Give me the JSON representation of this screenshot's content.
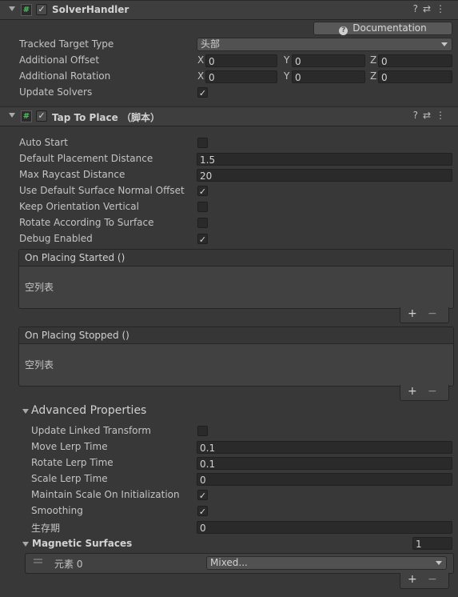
{
  "solver": {
    "title": "SolverHandler",
    "documentation_label": "Documentation",
    "tracked_target_type_label": "Tracked Target Type",
    "tracked_target_type_value": "头部",
    "additional_offset_label": "Additional Offset",
    "additional_offset": {
      "x": "0",
      "y": "0",
      "z": "0"
    },
    "additional_rotation_label": "Additional Rotation",
    "additional_rotation": {
      "x": "0",
      "y": "0",
      "z": "0"
    },
    "axis_x": "X",
    "axis_y": "Y",
    "axis_z": "Z",
    "update_solvers_label": "Update Solvers",
    "update_solvers_checked": true
  },
  "tap": {
    "title": "Tap To Place （脚本）",
    "auto_start_label": "Auto Start",
    "default_placement_distance_label": "Default Placement Distance",
    "default_placement_distance": "1.5",
    "max_raycast_distance_label": "Max Raycast Distance",
    "max_raycast_distance": "20",
    "use_default_surface_normal_offset_label": "Use Default Surface Normal Offset",
    "keep_orientation_vertical_label": "Keep Orientation Vertical",
    "rotate_according_to_surface_label": "Rotate According To Surface",
    "debug_enabled_label": "Debug Enabled",
    "on_placing_started_label": "On Placing Started ()",
    "on_placing_stopped_label": "On Placing Stopped ()",
    "empty_list_label": "空列表",
    "plus": "+",
    "minus": "−",
    "advanced_properties_label": "Advanced Properties",
    "update_linked_transform_label": "Update Linked Transform",
    "move_lerp_time_label": "Move Lerp Time",
    "move_lerp_time": "0.1",
    "rotate_lerp_time_label": "Rotate Lerp Time",
    "rotate_lerp_time": "0.1",
    "scale_lerp_time_label": "Scale Lerp Time",
    "scale_lerp_time": "0",
    "maintain_scale_label": "Maintain Scale On Initialization",
    "smoothing_label": "Smoothing",
    "lifetime_label": "生存期",
    "lifetime": "0",
    "magnetic_surfaces_label": "Magnetic Surfaces",
    "magnetic_surfaces_count": "1",
    "element_0_label": "元素 0",
    "element_0_value": "Mixed..."
  },
  "icons": {
    "help": "?",
    "settings": "⇄",
    "more": "⋮",
    "check": "✓",
    "hash": "#"
  }
}
